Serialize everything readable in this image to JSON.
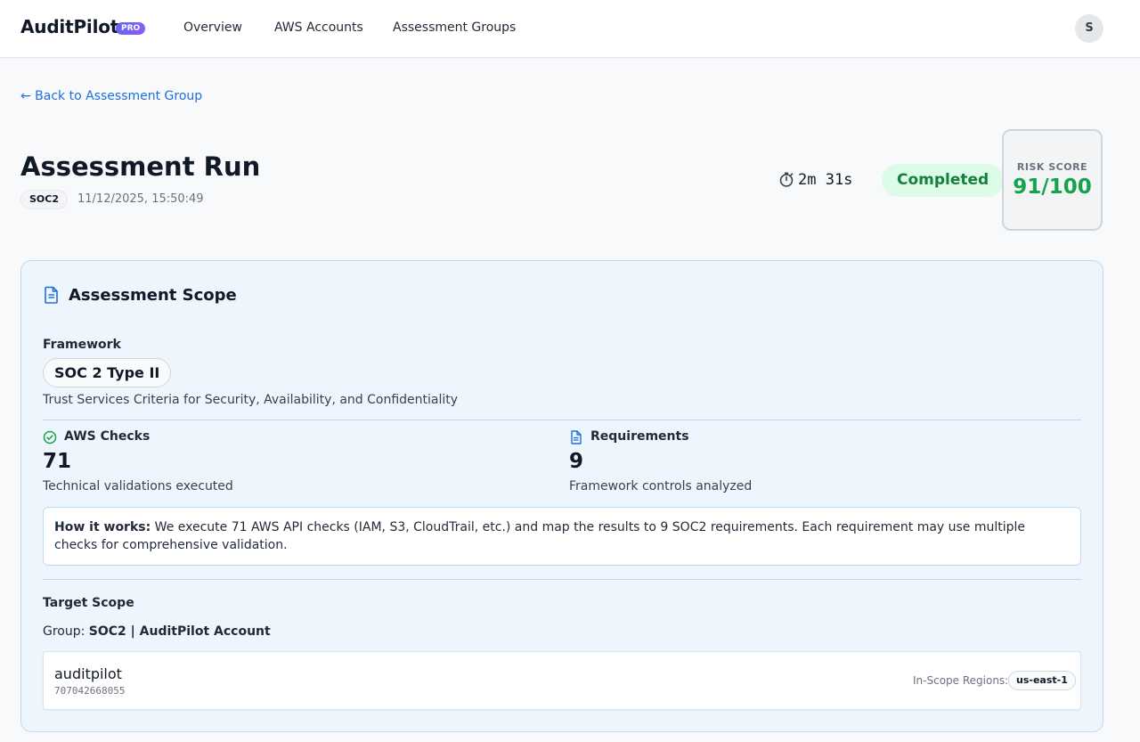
{
  "app": {
    "name": "AuditPilot",
    "badge": "PRO"
  },
  "nav": {
    "items": [
      {
        "label": "Overview"
      },
      {
        "label": "AWS Accounts"
      },
      {
        "label": "Assessment Groups"
      }
    ]
  },
  "user": {
    "avatar_initial": "S"
  },
  "back_link": "← Back to Assessment Group",
  "header": {
    "title": "Assessment Run",
    "framework_chip": "SOC2",
    "run_datetime": "11/12/2025, 15:50:49",
    "duration": "2m 31s",
    "status": "Completed",
    "risk_score_label": "RISK SCORE",
    "risk_score_value": "91/100"
  },
  "scope": {
    "title": "Assessment Scope",
    "framework_label": "Framework",
    "framework_name": "SOC 2 Type II",
    "framework_description": "Trust Services Criteria for Security, Availability, and Confidentiality",
    "aws_checks": {
      "label": "AWS Checks",
      "value": "71",
      "caption": "Technical validations executed"
    },
    "requirements": {
      "label": "Requirements",
      "value": "9",
      "caption": "Framework controls analyzed"
    },
    "how_it_works": {
      "label": "How it works:",
      "text": "We execute 71 AWS API checks (IAM, S3, CloudTrail, etc.) and map the results to 9 SOC2 requirements. Each requirement may use multiple checks for comprehensive validation."
    },
    "target_scope_label": "Target Scope",
    "group_prefix": "Group:",
    "group_name": "SOC2 | AuditPilot Account",
    "account": {
      "name": "auditpilot",
      "id": "707042668055",
      "regions_label": "In-Scope Regions:",
      "regions": [
        "us-east-1"
      ]
    }
  },
  "colors": {
    "accent": "#1d6fdc",
    "success": "#16a34a",
    "status_bg": "#dcfce7",
    "scope_bg": "#eef5fd"
  }
}
